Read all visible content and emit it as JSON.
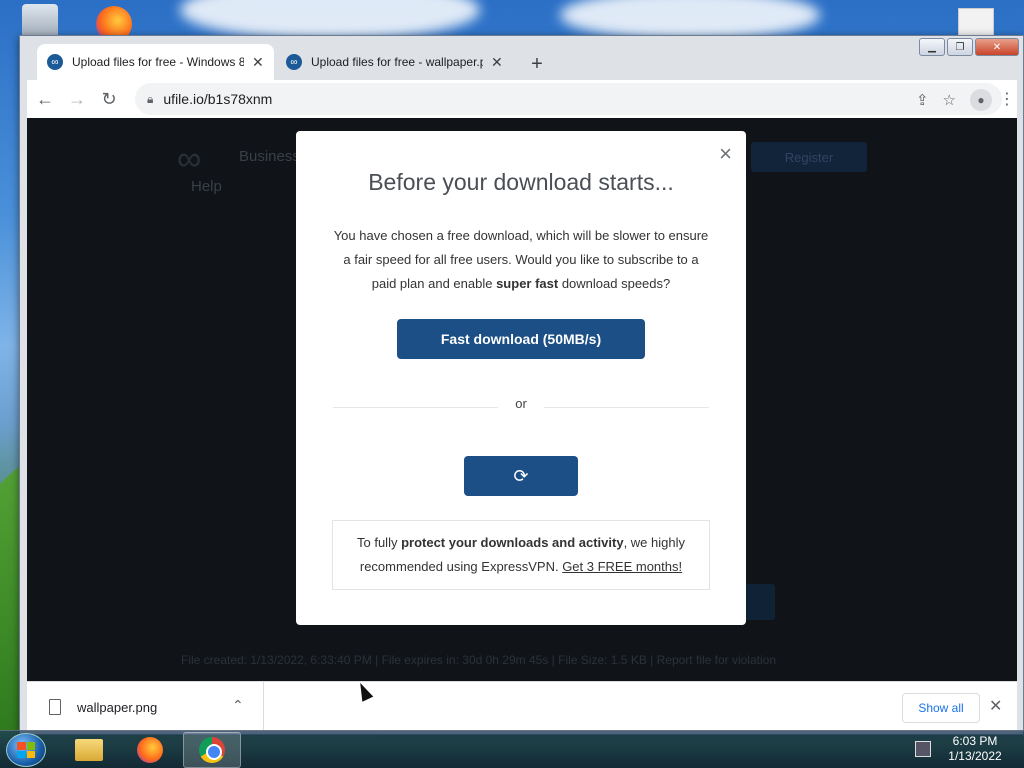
{
  "browser": {
    "tabs": [
      {
        "title": "Upload files for free - Windows 8",
        "active": true
      },
      {
        "title": "Upload files for free - wallpaper.p",
        "active": false
      }
    ],
    "address": "ufile.io/b1s78xnm"
  },
  "page": {
    "help": "Help",
    "business": "Business",
    "register": "Register",
    "footer": "File created: 1/13/2022, 6:33:40 PM   |   File expires in: 30d 0h 29m 45s   |   File Size: 1.5 KB   |   Report file for violation"
  },
  "modal": {
    "title": "Before your download starts...",
    "text_part1": "You have chosen a free download, which will be slower to ensure a fair speed for all free users. Would you like to subscribe to a paid plan and enable ",
    "text_bold": "super fast",
    "text_part2": " download speeds?",
    "fast_button": "Fast download (50MB/s)",
    "or": "or",
    "vpn_part1": "To fully ",
    "vpn_bold": "protect your downloads and activity",
    "vpn_part2": ", we highly recommended using ExpressVPN. ",
    "vpn_link": "Get 3 FREE months!",
    "close_glyph": "×",
    "spinner_glyph": "⟳"
  },
  "downloads": {
    "filename": "wallpaper.png",
    "show_all": "Show all"
  },
  "taskbar": {
    "time": "6:03 PM",
    "date": "1/13/2022"
  },
  "colors": {
    "primary_button": "#1b4f86",
    "link_blue": "#1a73e8"
  }
}
